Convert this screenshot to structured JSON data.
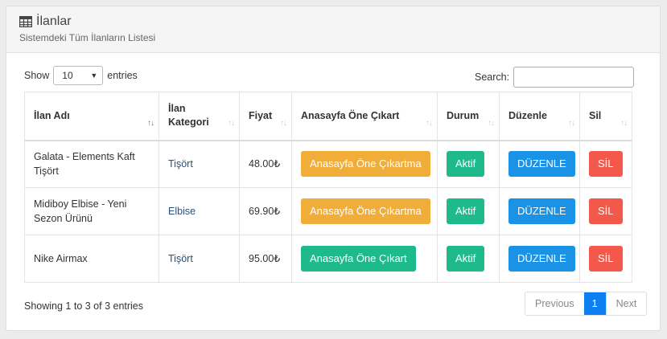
{
  "header": {
    "title": "İlanlar",
    "subtitle": "Sistemdeki Tüm İlanların Listesi",
    "icon": "table-icon"
  },
  "controls": {
    "show_label": "Show",
    "page_size": "10",
    "entries_label": "entries",
    "search_label": "Search:",
    "search_value": ""
  },
  "table": {
    "columns": [
      "İlan Adı",
      "İlan Kategori",
      "Fiyat",
      "Anasayfa Öne Çıkart",
      "Durum",
      "Düzenle",
      "Sil"
    ],
    "column_lines": [
      [
        "İlan Adı"
      ],
      [
        "İlan",
        "Kategori"
      ],
      [
        "Fiyat"
      ],
      [
        "Anasayfa Öne Çıkart"
      ],
      [
        "Durum"
      ],
      [
        "Düzenle"
      ],
      [
        "Sil"
      ]
    ],
    "rows": [
      {
        "name": "Galata - Elements Kaft Tişört",
        "category": "Tişört",
        "price": "48.00₺",
        "feature": "Anasayfa Öne Çıkartma",
        "feature_color": "#f0ad3a",
        "status": "Aktif",
        "edit": "DÜZENLE",
        "delete": "SİL"
      },
      {
        "name": "Midiboy Elbise - Yeni Sezon Ürünü",
        "category": "Elbise",
        "price": "69.90₺",
        "feature": "Anasayfa Öne Çıkartma",
        "feature_color": "#f0ad3a",
        "status": "Aktif",
        "edit": "DÜZENLE",
        "delete": "SİL"
      },
      {
        "name": "Nike Airmax",
        "category": "Tişört",
        "price": "95.00₺",
        "feature": "Anasayfa Öne Çıkart",
        "feature_color": "#1fba8c",
        "status": "Aktif",
        "edit": "DÜZENLE",
        "delete": "SİL"
      }
    ]
  },
  "footer": {
    "info": "Showing 1 to 3 of 3 entries",
    "previous": "Previous",
    "current_page": "1",
    "next": "Next"
  },
  "colors": {
    "warning": "#f0ad3a",
    "success": "#1fba8c",
    "primary": "#1a93e6",
    "danger": "#f4584a",
    "pager_active": "#0d7ff0"
  }
}
